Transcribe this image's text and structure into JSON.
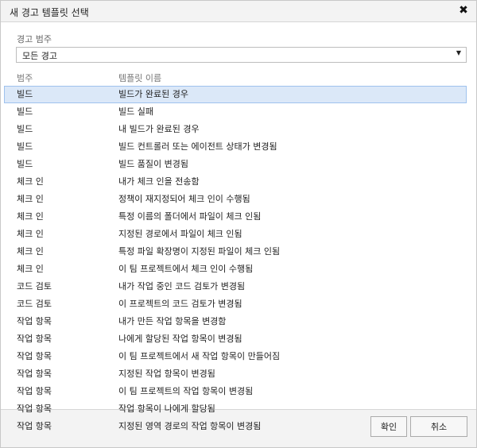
{
  "dialog": {
    "title": "새 경고 템플릿 선택",
    "close_icon": "close-icon"
  },
  "category_filter": {
    "label": "경고 범주",
    "selected": "모든 경고"
  },
  "columns": {
    "category": "범주",
    "template_name": "템플릿 이름"
  },
  "rows": [
    {
      "category": "빌드",
      "name": "빌드가 완료된 경우",
      "selected": true
    },
    {
      "category": "빌드",
      "name": "빌드 실패"
    },
    {
      "category": "빌드",
      "name": "내 빌드가 완료된 경우"
    },
    {
      "category": "빌드",
      "name": "빌드 컨트롤러 또는 에이전트 상태가 변경됨"
    },
    {
      "category": "빌드",
      "name": "빌드 품질이 변경됨"
    },
    {
      "category": "체크 인",
      "name": "내가 체크 인을 전송함"
    },
    {
      "category": "체크 인",
      "name": "정책이 재지정되어 체크 인이 수행됨"
    },
    {
      "category": "체크 인",
      "name": "특정 이름의 폴더에서 파일이 체크 인됨"
    },
    {
      "category": "체크 인",
      "name": "지정된 경로에서 파일이 체크 인됨"
    },
    {
      "category": "체크 인",
      "name": "특정 파일 확장명이 지정된 파일이 체크 인됨"
    },
    {
      "category": "체크 인",
      "name": "이 팀 프로젝트에서 체크 인이 수행됨"
    },
    {
      "category": "코드 검토",
      "name": "내가 작업 중인 코드 검토가 변경됨"
    },
    {
      "category": "코드 검토",
      "name": "이 프로젝트의 코드 검토가 변경됨"
    },
    {
      "category": "작업 항목",
      "name": "내가 만든 작업 항목을 변경함"
    },
    {
      "category": "작업 항목",
      "name": "나에게 할당된 작업 항목이 변경됨"
    },
    {
      "category": "작업 항목",
      "name": "이 팀 프로젝트에서 새 작업 항목이 만들어짐"
    },
    {
      "category": "작업 항목",
      "name": "지정된 작업 항목이 변경됨"
    },
    {
      "category": "작업 항목",
      "name": "이 팀 프로젝트의 작업 항목이 변경됨"
    },
    {
      "category": "작업 항목",
      "name": "작업 항목이 나에게 할당됨"
    },
    {
      "category": "작업 항목",
      "name": "지정된 영역 경로의 작업 항목이 변경됨"
    }
  ],
  "buttons": {
    "ok": "확인",
    "cancel": "취소"
  },
  "colors": {
    "selected_row_bg": "#dbe8f8",
    "selected_row_border": "#9fc2ee"
  }
}
